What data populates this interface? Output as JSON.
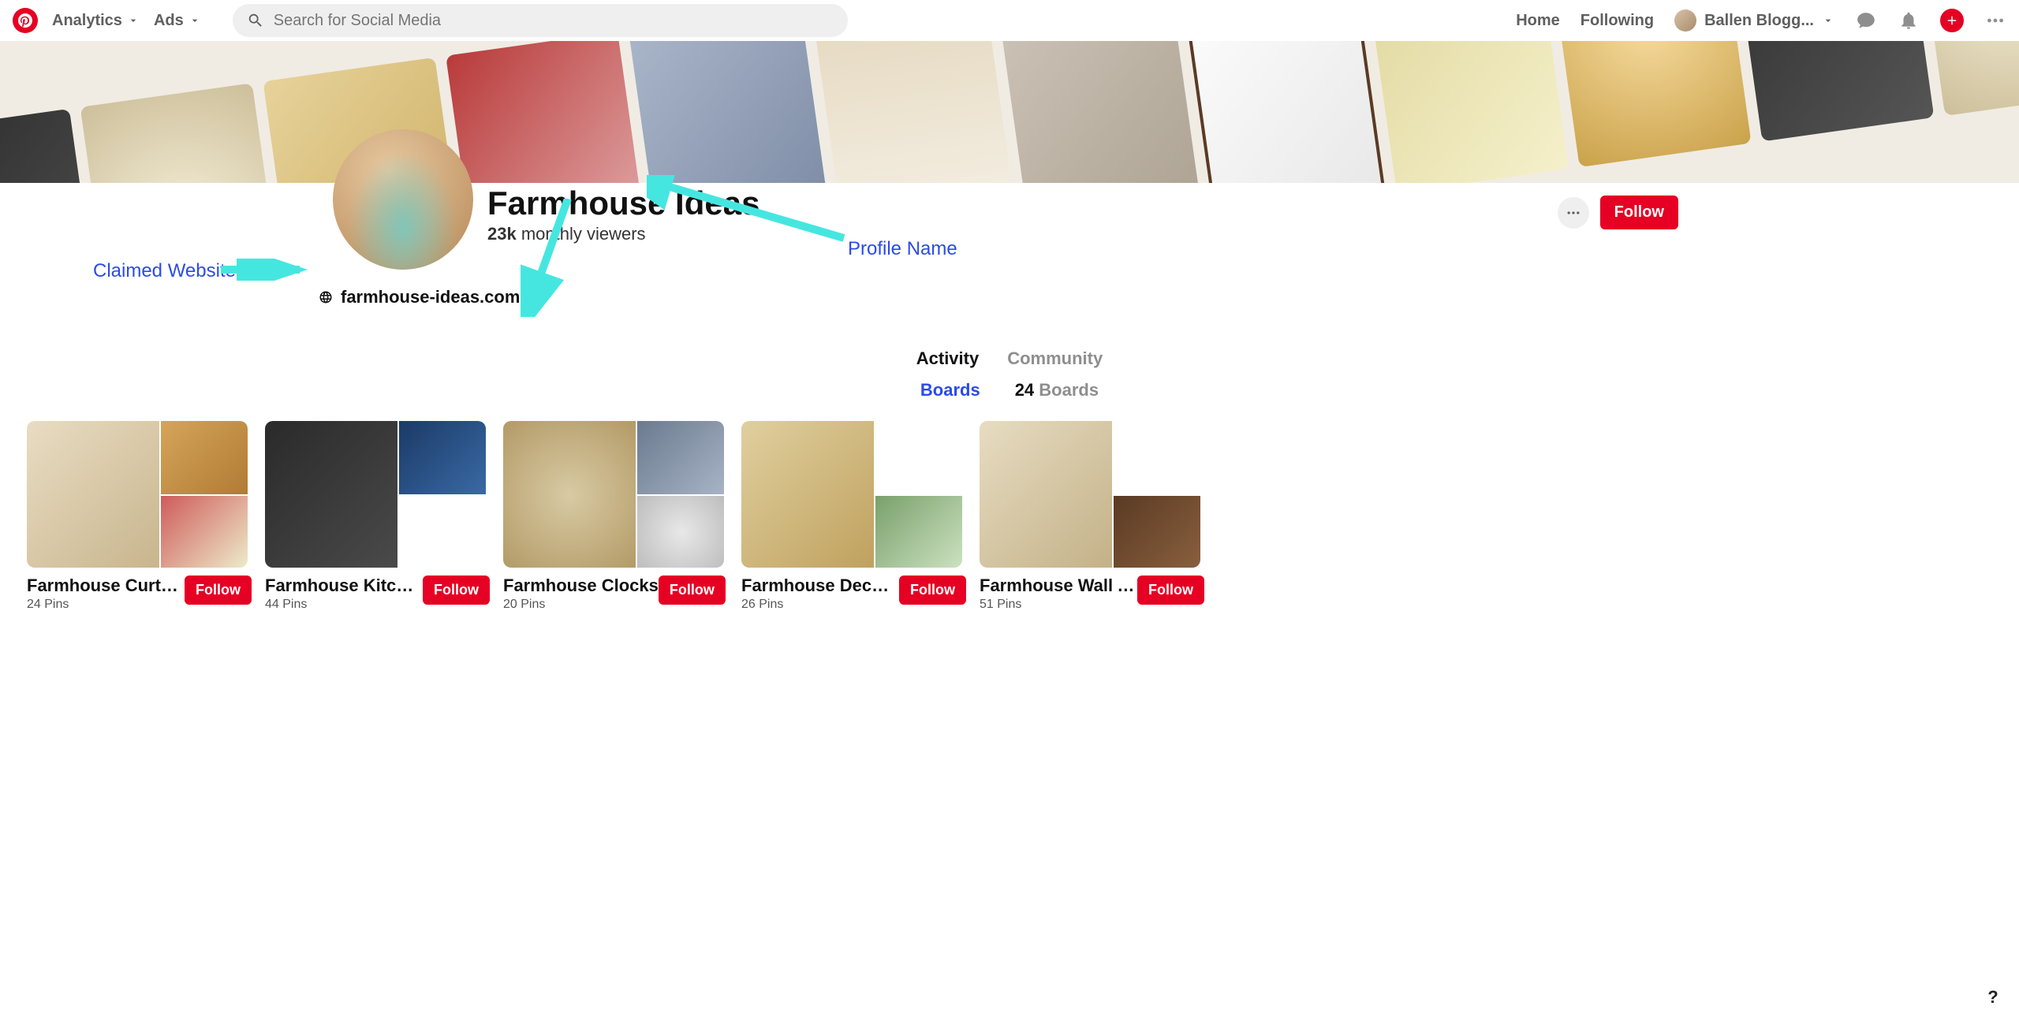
{
  "header": {
    "analytics_label": "Analytics",
    "ads_label": "Ads",
    "search_placeholder": "Search for Social Media",
    "home_label": "Home",
    "following_label": "Following",
    "username": "Ballen Blogg..."
  },
  "profile": {
    "name": "Farmhouse Ideas",
    "viewers_count": "23k",
    "viewers_label": "monthly viewers",
    "website": "farmhouse-ideas.com",
    "follow_label": "Follow"
  },
  "annotations": {
    "claimed_website": "Claimed Website",
    "profile_name": "Profile Name"
  },
  "tabs": {
    "activity": "Activity",
    "community": "Community",
    "boards_label": "Boards",
    "boards_count": "24",
    "boards_word": "Boards"
  },
  "boards": [
    {
      "title": "Farmhouse Curtains...",
      "pins": "24 Pins",
      "follow": "Follow"
    },
    {
      "title": "Farmhouse Kitchen ...",
      "pins": "44 Pins",
      "follow": "Follow"
    },
    {
      "title": "Farmhouse Clocks",
      "pins": "20 Pins",
      "follow": "Follow"
    },
    {
      "title": "Farmhouse Decorati...",
      "pins": "26 Pins",
      "follow": "Follow"
    },
    {
      "title": "Farmhouse Wall Art ...",
      "pins": "51 Pins",
      "follow": "Follow"
    }
  ],
  "help_symbol": "?"
}
